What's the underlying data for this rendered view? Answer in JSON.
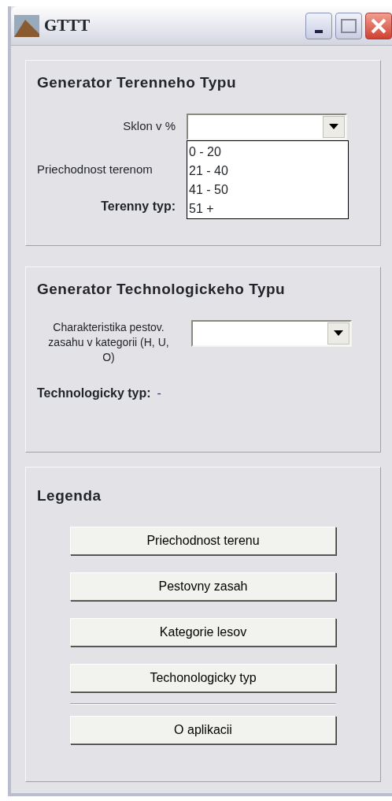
{
  "window": {
    "title": "GTTT"
  },
  "terrain": {
    "heading": "Generator Terenneho Typu",
    "slope_label": "Sklon v %",
    "slope_options": [
      {
        "label": "0 - 20"
      },
      {
        "label": "21 - 40"
      },
      {
        "label": "41 - 50"
      },
      {
        "label": "51 +"
      }
    ],
    "passability_label": "Priechodnost terenom",
    "type_label": "Terenny typ:"
  },
  "technology": {
    "heading": "Generator Technologickeho Typu",
    "characteristic_label": "Charakteristika pestov. zasahu v kategorii (H, U, O)",
    "type_label": "Technologicky typ:",
    "type_value": "-"
  },
  "legend": {
    "heading": "Legenda",
    "buttons": [
      {
        "label": "Priechodnost terenu",
        "kind": "legend"
      },
      {
        "label": "Pestovny zasah",
        "kind": "legend"
      },
      {
        "label": "Kategorie lesov",
        "kind": "legend"
      },
      {
        "label": "Techonologicky typ",
        "kind": "legend"
      },
      {
        "label": "O aplikacii",
        "kind": "about"
      }
    ]
  }
}
